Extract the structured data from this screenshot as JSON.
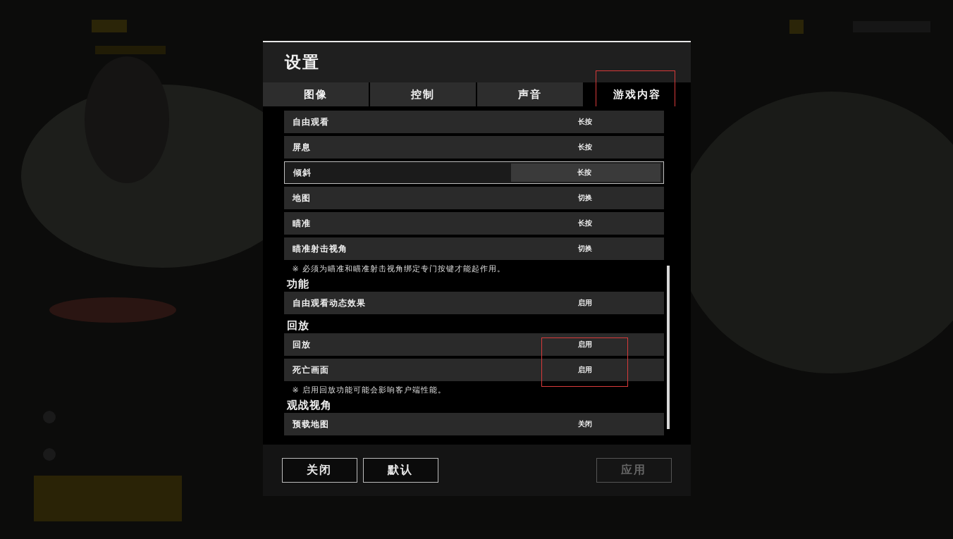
{
  "window": {
    "title": "设置"
  },
  "tabs": [
    {
      "label": "图像",
      "selected": false,
      "highlighted": false
    },
    {
      "label": "控制",
      "selected": false,
      "highlighted": false
    },
    {
      "label": "声音",
      "selected": false,
      "highlighted": false
    },
    {
      "label": "游戏内容",
      "selected": true,
      "highlighted": true
    }
  ],
  "sections": [
    {
      "rows": [
        {
          "label": "自由观看",
          "value": "长按",
          "focused": false,
          "highlighted": false
        },
        {
          "label": "屏息",
          "value": "长按",
          "focused": false,
          "highlighted": false
        },
        {
          "label": "倾斜",
          "value": "长按",
          "focused": true,
          "highlighted": false
        },
        {
          "label": "地图",
          "value": "切换",
          "focused": false,
          "highlighted": false
        },
        {
          "label": "瞄准",
          "value": "长按",
          "focused": false,
          "highlighted": false
        },
        {
          "label": "瞄准射击视角",
          "value": "切换",
          "focused": false,
          "highlighted": false
        }
      ],
      "note": "※ 必须为瞄准和瞄准射击视角绑定专门按键才能起作用。"
    },
    {
      "heading": "功能",
      "rows": [
        {
          "label": "自由观看动态效果",
          "value": "启用",
          "focused": false,
          "highlighted": false
        }
      ]
    },
    {
      "heading": "回放",
      "rows": [
        {
          "label": "回放",
          "value": "启用",
          "focused": false,
          "highlighted": true
        },
        {
          "label": "死亡画面",
          "value": "启用",
          "focused": false,
          "highlighted": true
        }
      ],
      "note": "※ 启用回放功能可能会影响客户端性能。"
    },
    {
      "heading": "观战视角",
      "rows": [
        {
          "label": "预载地图",
          "value": "关闭",
          "focused": false,
          "highlighted": false
        }
      ]
    }
  ],
  "buttons": [
    {
      "label": "关闭",
      "disabled": false
    },
    {
      "label": "默认",
      "disabled": false
    },
    {
      "label": "应用",
      "disabled": true
    }
  ]
}
